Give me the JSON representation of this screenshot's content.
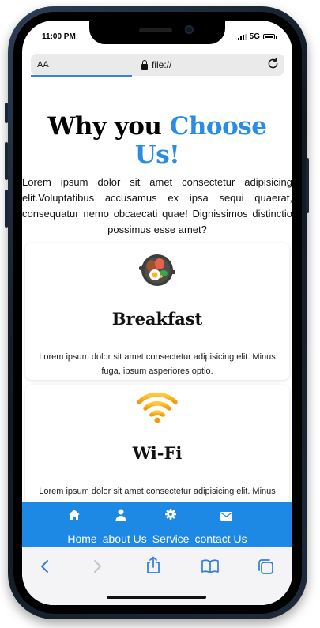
{
  "status_bar": {
    "time": "11:00 PM",
    "network": "5G"
  },
  "browser": {
    "text_size_label": "AA",
    "url": "file://",
    "icons": {
      "lock": "lock-icon",
      "reload": "reload-icon"
    },
    "toolbar": [
      "back-icon",
      "forward-icon",
      "share-icon",
      "bookmarks-icon",
      "tabs-icon"
    ]
  },
  "page": {
    "heading_main": "Why you ",
    "heading_accent": "Choose Us!",
    "intro": "Lorem ipsum dolor sit amet consectetur adipisicing elit.Voluptatibus accusamus ex ipsa sequi quaerat, consequatur nemo obcaecati quae! Dignissimos distinctio possimus esse amet?",
    "cards": [
      {
        "title": "Breakfast",
        "text": "Lorem ipsum dolor sit amet consectetur adipisicing elit. Minus fuga, ipsum asperiores optio.",
        "icon": "breakfast-pan-icon"
      },
      {
        "title": "Wi-Fi",
        "text": "Lorem ipsum dolor sit amet consectetur adipisicing elit. Minus fuga, ipsum asperiores optio.",
        "icon": "wifi-icon"
      }
    ]
  },
  "nav": {
    "items": [
      {
        "label": "Home",
        "icon": "home-icon"
      },
      {
        "label": "about Us",
        "icon": "user-icon"
      },
      {
        "label": "Service",
        "icon": "gear-icon"
      },
      {
        "label": "contact Us",
        "icon": "envelope-icon"
      }
    ]
  },
  "colors": {
    "accent": "#2a8ce3",
    "nav_bg": "#1e88e5",
    "wifi": "#f7a21b"
  }
}
